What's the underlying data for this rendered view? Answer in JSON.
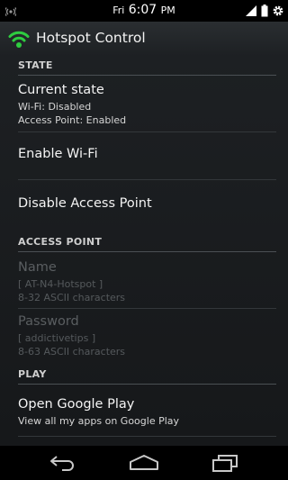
{
  "status_bar": {
    "day": "Fri",
    "time": "6:07",
    "meridiem": "PM"
  },
  "action_bar": {
    "title": "Hotspot Control",
    "icon": "wifi-hotspot-icon",
    "icon_color": "#2ecc40"
  },
  "sections": {
    "state": {
      "header": "STATE",
      "current_state_title": "Current state",
      "wifi_status": "Wi-Fi: Disabled",
      "ap_status": "Access Point: Enabled",
      "enable_wifi": "Enable Wi-Fi",
      "disable_ap": "Disable Access Point"
    },
    "access_point": {
      "header": "ACCESS POINT",
      "name_title": "Name",
      "name_value": "[ AT-N4-Hotspot ]",
      "name_hint": "8-32 ASCII characters",
      "password_title": "Password",
      "password_value": "[ addictivetips ]",
      "password_hint": "8-63 ASCII characters"
    },
    "play": {
      "header": "PLAY",
      "open_title": "Open Google Play",
      "open_subtitle": "View all my apps on Google Play"
    }
  },
  "nav_bar": {
    "icons": [
      "back-icon",
      "home-icon",
      "recent-apps-icon"
    ]
  }
}
